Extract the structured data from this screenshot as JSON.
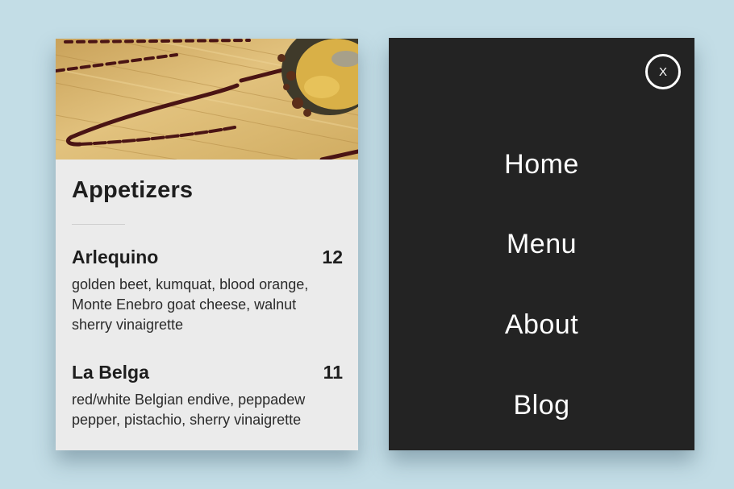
{
  "menu_card": {
    "image_subject": "dessert-on-wooden-board-photo",
    "section_title": "Appetizers",
    "items": [
      {
        "name": "Arlequino",
        "price": "12",
        "description": "golden beet, kumquat, blood orange, Monte Enebro goat cheese, walnut sherry vinaigrette"
      },
      {
        "name": "La Belga",
        "price": "11",
        "description": "red/white Belgian endive, peppadew pepper, pistachio, sherry vinaigrette"
      }
    ]
  },
  "nav_panel": {
    "close_label": "X",
    "items": [
      {
        "label": "Home"
      },
      {
        "label": "Menu"
      },
      {
        "label": "About"
      },
      {
        "label": "Blog"
      }
    ]
  },
  "colors": {
    "page_background": "#c3dde6",
    "card_background": "#ebebeb",
    "panel_background": "#232323",
    "text_dark": "#1e1e1e",
    "text_light": "#ffffff"
  }
}
